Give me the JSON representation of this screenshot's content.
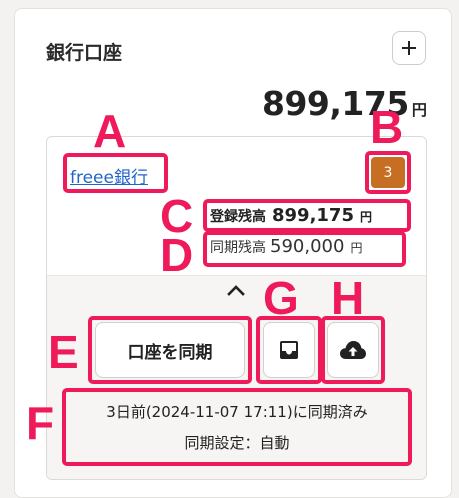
{
  "card": {
    "title": "銀行口座",
    "add_icon": "plus-icon",
    "total_amount": "899,175",
    "total_unit": "円"
  },
  "account": {
    "bank_name": "freee銀行",
    "badge_count": "3",
    "badge_color": "#c66f23",
    "registered": {
      "label": "登録残高",
      "amount": "899,175",
      "unit": "円"
    },
    "synced": {
      "label": "同期残高",
      "amount": "590,000",
      "unit": "円"
    },
    "collapse_icon": "chevron-up-icon",
    "sync_button_label": "口座を同期",
    "inbox_icon": "inbox-icon",
    "upload_icon": "cloud-upload-icon",
    "status_line1": "3日前(2024-11-07 17:11)に同期済み",
    "status_line2": "同期設定：自動"
  },
  "annotations": {
    "color": "#ee1a5a",
    "labels": [
      "A",
      "B",
      "C",
      "D",
      "E",
      "F",
      "G",
      "H"
    ]
  }
}
